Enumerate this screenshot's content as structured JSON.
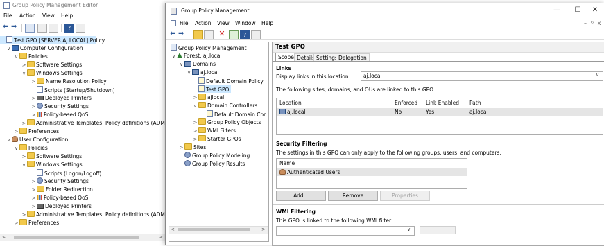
{
  "editor": {
    "title": "Group Policy Management Editor",
    "menu": [
      "File",
      "Action",
      "View",
      "Help"
    ],
    "tree": [
      {
        "label": "Test GPO [SERVER.AJ.LOCAL] Policy",
        "icon": "doc-icon",
        "chev": ""
      },
      {
        "label": "Computer Configuration",
        "icon": "computer-icon",
        "chev": "∨"
      },
      {
        "label": "Policies",
        "icon": "folder-icon",
        "chev": "∨"
      },
      {
        "label": "Software Settings",
        "icon": "folder-icon",
        "chev": ">"
      },
      {
        "label": "Windows Settings",
        "icon": "folder-icon",
        "chev": "∨"
      },
      {
        "label": "Name Resolution Policy",
        "icon": "folder-icon",
        "chev": ">"
      },
      {
        "label": "Scripts (Startup/Shutdown)",
        "icon": "doc-icon",
        "chev": ""
      },
      {
        "label": "Deployed Printers",
        "icon": "printer-icon",
        "chev": ">"
      },
      {
        "label": "Security Settings",
        "icon": "gear-icon",
        "chev": ">"
      },
      {
        "label": "Policy-based QoS",
        "icon": "chart-icon",
        "chev": ">"
      },
      {
        "label": "Administrative Templates: Policy definitions (ADMX fi",
        "icon": "folder-icon",
        "chev": ">"
      },
      {
        "label": "Preferences",
        "icon": "folder-icon",
        "chev": ">"
      },
      {
        "label": "User Configuration",
        "icon": "user-icon",
        "chev": "∨"
      },
      {
        "label": "Policies",
        "icon": "folder-icon",
        "chev": "∨"
      },
      {
        "label": "Software Settings",
        "icon": "folder-icon",
        "chev": ">"
      },
      {
        "label": "Windows Settings",
        "icon": "folder-icon",
        "chev": "∨"
      },
      {
        "label": "Scripts (Logon/Logoff)",
        "icon": "doc-icon",
        "chev": ""
      },
      {
        "label": "Security Settings",
        "icon": "gear-icon",
        "chev": ">"
      },
      {
        "label": "Folder Redirection",
        "icon": "folder-icon",
        "chev": ">"
      },
      {
        "label": "Policy-based QoS",
        "icon": "chart-icon",
        "chev": ">"
      },
      {
        "label": "Deployed Printers",
        "icon": "printer-icon",
        "chev": ">"
      },
      {
        "label": "Administrative Templates: Policy definitions (ADMX fi",
        "icon": "folder-icon",
        "chev": ">"
      },
      {
        "label": "Preferences",
        "icon": "folder-icon",
        "chev": ">"
      }
    ]
  },
  "gpm": {
    "title": "Group Policy Management",
    "menu": [
      "File",
      "Action",
      "View",
      "Window",
      "Help"
    ],
    "window_controls": [
      "—",
      "☐",
      "✕"
    ],
    "inner_controls": [
      "–",
      "ᴳ",
      "x"
    ],
    "tree": [
      {
        "label": "Group Policy Management",
        "icon": "gpm-icon",
        "chev": ""
      },
      {
        "label": "Forest: aj.local",
        "icon": "forest-icon",
        "chev": "∨"
      },
      {
        "label": "Domains",
        "icon": "domain-icon",
        "chev": "∨"
      },
      {
        "label": "aj.local",
        "icon": "domain-icon",
        "chev": "∨"
      },
      {
        "label": "Default Domain Policy",
        "icon": "gpo-link-icon",
        "chev": ""
      },
      {
        "label": "Test GPO",
        "icon": "gpo-link-icon",
        "chev": ""
      },
      {
        "label": "ajlocal",
        "icon": "folder-icon",
        "chev": ">"
      },
      {
        "label": "Domain Controllers",
        "icon": "folder-icon",
        "chev": "∨"
      },
      {
        "label": "Default Domain Cor",
        "icon": "gpo-link-icon",
        "chev": ""
      },
      {
        "label": "Group Policy Objects",
        "icon": "folder-icon",
        "chev": ">"
      },
      {
        "label": "WMI Filters",
        "icon": "folder-icon",
        "chev": ">"
      },
      {
        "label": "Starter GPOs",
        "icon": "folder-icon",
        "chev": ">"
      },
      {
        "label": "Sites",
        "icon": "folder-icon",
        "chev": ">"
      },
      {
        "label": "Group Policy Modeling",
        "icon": "gear-icon",
        "chev": ""
      },
      {
        "label": "Group Policy Results",
        "icon": "gear-icon",
        "chev": ""
      }
    ],
    "panel_title": "Test GPO",
    "tabs": [
      "Scope",
      "Details",
      "Settings",
      "Delegation"
    ],
    "links": {
      "title": "Links",
      "display_label": "Display links in this location:",
      "location_value": "aj.local",
      "desc": "The following sites, domains, and OUs are linked to this GPO:",
      "columns": [
        "Location",
        "Enforced",
        "Link Enabled",
        "Path"
      ],
      "rows": [
        {
          "location": "aj.local",
          "enforced": "No",
          "link_enabled": "Yes",
          "path": "aj.local"
        }
      ]
    },
    "security": {
      "title": "Security Filtering",
      "desc": "The settings in this GPO can only apply to the following groups, users, and computers:",
      "column": "Name",
      "items": [
        "Authenticated Users"
      ],
      "buttons": [
        "Add...",
        "Remove",
        "Properties"
      ]
    },
    "wmi": {
      "title": "WMI Filtering",
      "desc": "This GPO is linked to the following WMI filter:"
    }
  }
}
